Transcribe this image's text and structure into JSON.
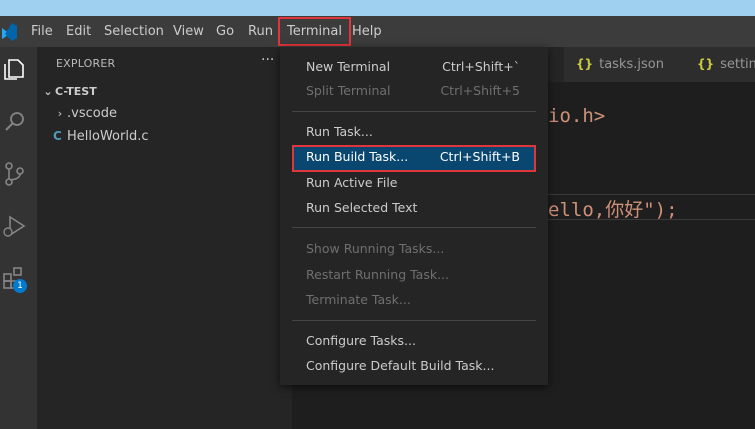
{
  "titlebar": {
    "menus": [
      "File",
      "Edit",
      "Selection",
      "View",
      "Go",
      "Run",
      "Terminal",
      "Help"
    ]
  },
  "activitybar": {
    "badge": "1"
  },
  "explorer": {
    "title": "EXPLORER",
    "more": "···",
    "folder": "C-TEST",
    "items": [
      ".vscode",
      "HelloWorld.c"
    ],
    "c_icon": "C"
  },
  "editor": {
    "tabs": [
      {
        "icon": "{}",
        "label": "tasks.json"
      },
      {
        "icon": "{}",
        "label": "setting"
      }
    ],
    "code_line1": "io.h>",
    "code_line2": "ello,你好\");"
  },
  "terminal_menu": {
    "items": [
      {
        "label": "New Terminal",
        "shortcut": "Ctrl+Shift+`"
      },
      {
        "label": "Split Terminal",
        "shortcut": "Ctrl+Shift+5"
      },
      {
        "label": "Run Task..."
      },
      {
        "label": "Run Build Task...",
        "shortcut": "Ctrl+Shift+B"
      },
      {
        "label": "Run Active File"
      },
      {
        "label": "Run Selected Text"
      },
      {
        "label": "Show Running Tasks..."
      },
      {
        "label": "Restart Running Task..."
      },
      {
        "label": "Terminate Task..."
      },
      {
        "label": "Configure Tasks..."
      },
      {
        "label": "Configure Default Build Task..."
      }
    ]
  },
  "colors": {
    "accent": "#007acc",
    "highlight": "#e0353a",
    "selected": "#094771",
    "string": "#ce9178"
  }
}
